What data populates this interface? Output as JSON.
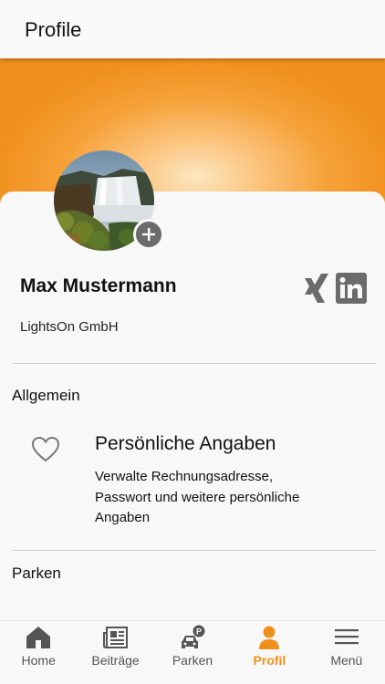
{
  "header": {
    "title": "Profile"
  },
  "profile": {
    "name": "Max Mustermann",
    "company": "LightsOn GmbH"
  },
  "sections": {
    "general": {
      "title": "Allgemein"
    },
    "parking": {
      "title": "Parken"
    }
  },
  "personal": {
    "title": "Persönliche Angaben",
    "description": "Verwalte Rechnungsadresse, Passwort und weitere persönliche Angaben"
  },
  "tabs": [
    {
      "label": "Home",
      "icon": "home-icon"
    },
    {
      "label": "Beiträge",
      "icon": "newspaper-icon"
    },
    {
      "label": "Parken",
      "icon": "car-parking-icon"
    },
    {
      "label": "Profil",
      "icon": "person-icon",
      "active": true
    },
    {
      "label": "Menü",
      "icon": "hamburger-menu-icon"
    }
  ],
  "colors": {
    "accent": "#f0901c",
    "icon_gray": "#6b6b6b",
    "text": "#111111"
  }
}
